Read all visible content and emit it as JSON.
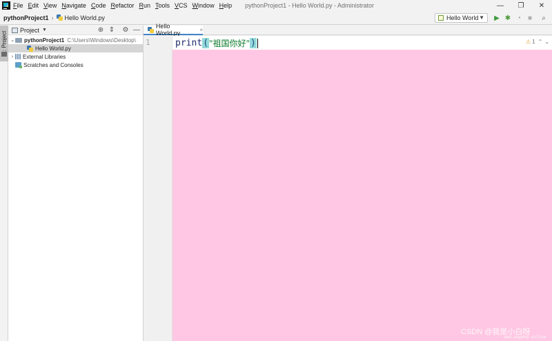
{
  "menubar": {
    "items": [
      "File",
      "Edit",
      "View",
      "Navigate",
      "Code",
      "Refactor",
      "Run",
      "Tools",
      "VCS",
      "Window",
      "Help"
    ],
    "window_title": "pythonProject1 - Hello World.py - Administrator"
  },
  "navbar": {
    "project": "pythonProject1",
    "file": "Hello World.py",
    "run_config": "Hello World"
  },
  "toolstripe": {
    "project_tab": "1: Project"
  },
  "project_panel": {
    "title": "Project",
    "tree": {
      "root_name": "pythonProject1",
      "root_path": "C:\\Users\\Windows\\Desktop\\",
      "file": "Hello World.py",
      "external_libraries": "External Libraries",
      "scratches": "Scratches and Consoles"
    }
  },
  "editor": {
    "tab_label": "Hello World.py",
    "line_number": "1",
    "code": {
      "keyword": "print",
      "open_paren": "(",
      "string": "\"祖国你好\"",
      "close_paren": ")"
    },
    "inspection_count": "1"
  },
  "watermark": {
    "text": "CSDN @我是小白呀",
    "sub": "www.aspphp.online"
  },
  "colors": {
    "editor_background": "#ffc7e3",
    "selection_tab_accent": "#4083c9",
    "bracket_highlight": "#93d9d9"
  },
  "icons": {
    "run": "play-icon",
    "debug": "bug-icon",
    "coverage": "coverage-icon",
    "stop": "stop-icon"
  }
}
